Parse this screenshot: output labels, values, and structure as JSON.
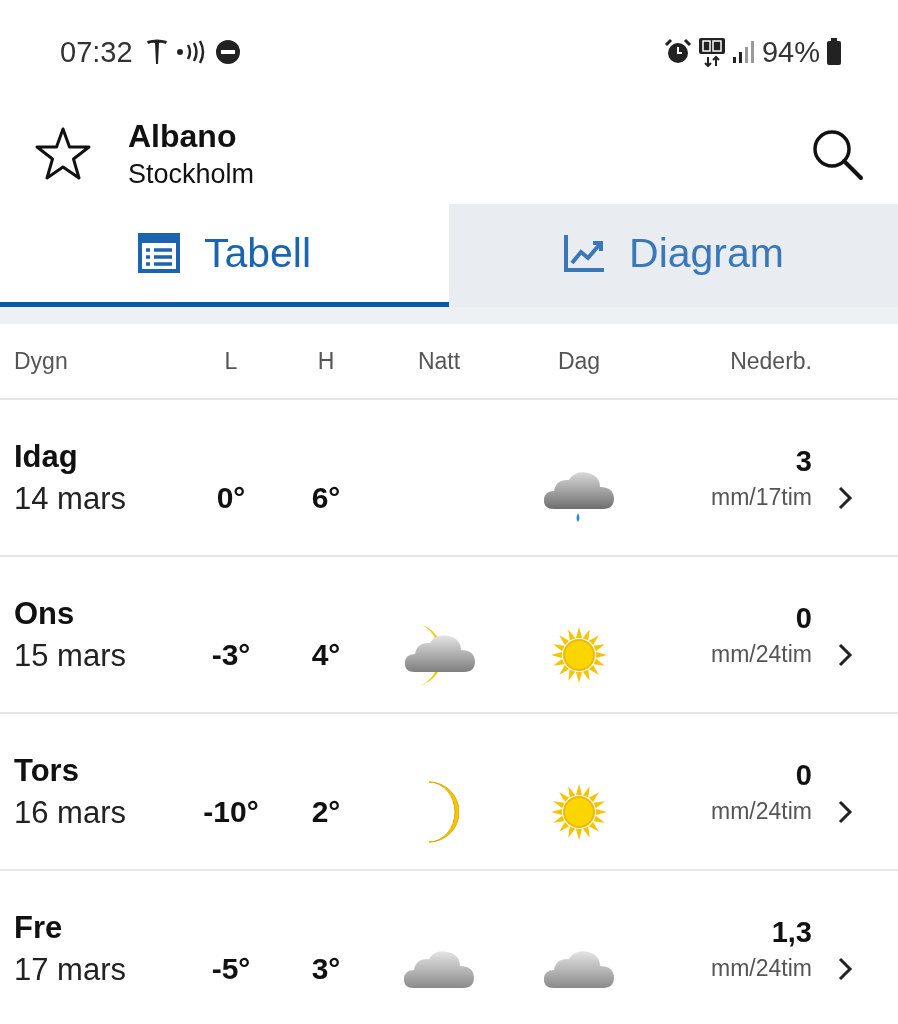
{
  "status_bar": {
    "time": "07:32",
    "battery": "94%"
  },
  "header": {
    "place": "Albano",
    "region": "Stockholm"
  },
  "tabs": [
    {
      "label": "Tabell",
      "selected": true,
      "kind": "table"
    },
    {
      "label": "Diagram",
      "selected": false,
      "kind": "chart"
    }
  ],
  "columns": [
    "Dygn",
    "L",
    "H",
    "Natt",
    "Dag",
    "Nederb."
  ],
  "rows": [
    {
      "day": "Idag",
      "date": "14 mars",
      "low": "0°",
      "high": "6°",
      "day_icon": {
        "kind": "rain-cloud"
      },
      "precip": "3",
      "unit": "mm/17tim"
    },
    {
      "day": "Ons",
      "date": "15 mars",
      "low": "-3°",
      "high": "4°",
      "night_icon": {
        "kind": "moon-cloud"
      },
      "day_icon": {
        "kind": "sun"
      },
      "precip": "0",
      "unit": "mm/24tim"
    },
    {
      "day": "Tors",
      "date": "16 mars",
      "low": "-10°",
      "high": "2°",
      "night_icon": {
        "kind": "moon"
      },
      "day_icon": {
        "kind": "sun"
      },
      "precip": "0",
      "unit": "mm/24tim"
    },
    {
      "day": "Fre",
      "date": "17 mars",
      "low": "-5°",
      "high": "3°",
      "night_icon": {
        "kind": "cloud"
      },
      "day_icon": {
        "kind": "cloud"
      },
      "precip": "1,3",
      "unit": "mm/24tim"
    }
  ]
}
